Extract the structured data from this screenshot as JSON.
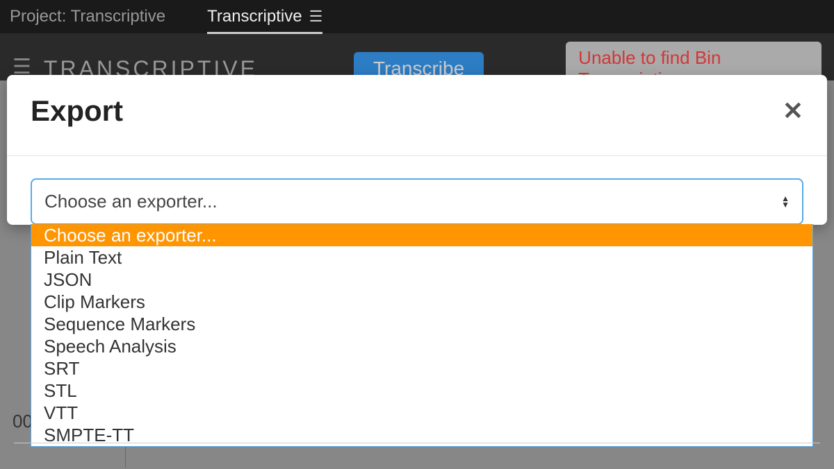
{
  "topbar": {
    "project_label": "Project: Transcriptive",
    "active_tab": "Transcriptive"
  },
  "header": {
    "app_title": "TRANSCRIPTIVE",
    "transcribe_btn": "Transcribe",
    "error_msg": "Unable to find Bin Transcriptive"
  },
  "content": {
    "timecode": "00"
  },
  "modal": {
    "title": "Export",
    "select_placeholder": "Choose an exporter...",
    "options": [
      "Choose an exporter...",
      "Plain Text",
      "JSON",
      "Clip Markers",
      "Sequence Markers",
      "Speech Analysis",
      "SRT",
      "STL",
      "VTT",
      "SMPTE-TT"
    ]
  }
}
